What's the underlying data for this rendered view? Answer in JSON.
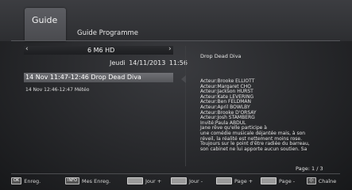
{
  "header": {
    "tab_label": "Guide",
    "title": "Guide Programme"
  },
  "channel": {
    "prev_arrow": "‹",
    "next_arrow": "›",
    "name": "6  M6 HD"
  },
  "datetime": "Jeudi  14/11/2013 11:56",
  "events": [
    {
      "label": "14 Nov 11:47-12:46  Drop Dead Diva",
      "selected": true
    },
    {
      "label": "14 Nov 12:46-12:47  Météo",
      "selected": false
    }
  ],
  "details": {
    "title": "Drop Dead Diva",
    "lines": [
      "Acteur:Brooke ELLIOTT",
      "Acteur:Margaret CHO",
      "Acteur:Jackson HURST",
      "Acteur:Kate LEVERING",
      "Acteur:Ben FELDMAN",
      "Acteur:April BOWLBY",
      "Acteur:Brooke D'ORSAY",
      "Acteur:Josh STAMBERG",
      "Invité:Paula ABDUL",
      "Jane rêve qu'elle participe à",
      "une comédie musicale déjantée mais, à son",
      "réveil, la réalité est nettement moins rose.",
      "Toujours sur le point d'être radiée du barreau,",
      "son cabinet ne lui apporte aucun soutien. Sa"
    ],
    "page": "Page:  1 / 3"
  },
  "footer": {
    "ok_key": "OK",
    "ok_label": "Enreg.",
    "info_key": "INFO",
    "info_label": "Mes Enreg.",
    "day_next": "Jour +",
    "day_prev": "Jour -",
    "page_next": "Page +",
    "page_prev": "Page -",
    "chain_key": "‹|›",
    "chain_label": "Chaîne"
  }
}
